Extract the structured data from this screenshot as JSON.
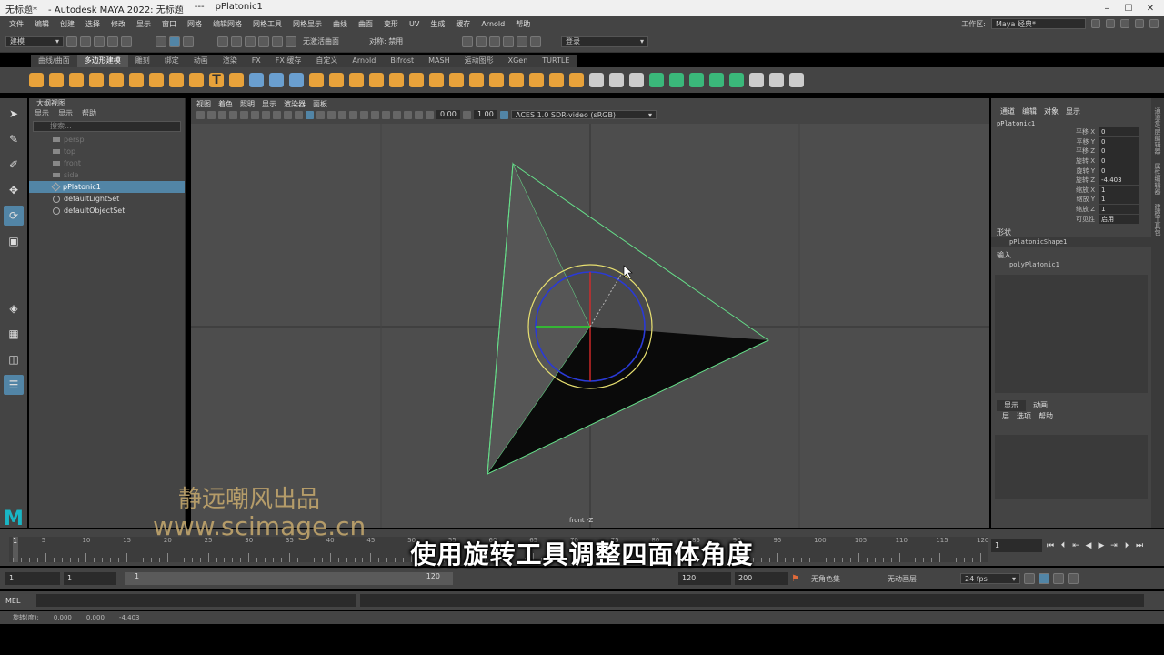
{
  "window": {
    "title_tab": "无标题*",
    "title": "- Autodesk MAYA 2022: 无标题",
    "separator": "---",
    "object": "pPlatonic1"
  },
  "menubar": {
    "items": [
      "文件",
      "编辑",
      "创建",
      "选择",
      "修改",
      "显示",
      "窗口",
      "网格",
      "编辑网格",
      "网格工具",
      "网格显示",
      "曲线",
      "曲面",
      "变形",
      "UV",
      "生成",
      "缓存",
      "Arnold",
      "帮助"
    ],
    "workspace_label": "工作区:",
    "workspace_value": "Maya 经典*"
  },
  "statusline": {
    "mode": "建模",
    "live_surface": "无激活曲面",
    "symmetry": "对称: 禁用",
    "login": "登录"
  },
  "shelf": {
    "tabs": [
      "曲线/曲面",
      "多边形建模",
      "雕刻",
      "绑定",
      "动画",
      "渲染",
      "FX",
      "FX 缓存",
      "自定义",
      "Arnold",
      "Bifrost",
      "MASH",
      "运动图形",
      "XGen",
      "TURTLE"
    ],
    "active_tab": 1
  },
  "outliner": {
    "title": "大纲视图",
    "menus": [
      "显示",
      "显示",
      "帮助"
    ],
    "search_placeholder": "搜索...",
    "items": [
      {
        "label": "persp",
        "type": "camera",
        "dim": true
      },
      {
        "label": "top",
        "type": "camera",
        "dim": true
      },
      {
        "label": "front",
        "type": "camera",
        "dim": true
      },
      {
        "label": "side",
        "type": "camera",
        "dim": true
      },
      {
        "label": "pPlatonic1",
        "type": "mesh",
        "selected": true
      },
      {
        "label": "defaultLightSet",
        "type": "set"
      },
      {
        "label": "defaultObjectSet",
        "type": "set"
      }
    ]
  },
  "viewport": {
    "menus": [
      "视图",
      "着色",
      "照明",
      "显示",
      "渲染器",
      "面板"
    ],
    "exposure": "0.00",
    "gamma": "1.00",
    "color_space": "ACES 1.0 SDR-video (sRGB)",
    "camera_label": "front -Z"
  },
  "channelbox": {
    "menus": [
      "通道",
      "编辑",
      "对象",
      "显示"
    ],
    "object": "pPlatonic1",
    "channels": [
      {
        "label": "平移 X",
        "value": "0"
      },
      {
        "label": "平移 Y",
        "value": "0"
      },
      {
        "label": "平移 Z",
        "value": "0"
      },
      {
        "label": "旋转 X",
        "value": "0"
      },
      {
        "label": "旋转 Y",
        "value": "0"
      },
      {
        "label": "旋转 Z",
        "value": "-4.403"
      },
      {
        "label": "缩放 X",
        "value": "1"
      },
      {
        "label": "缩放 Y",
        "value": "1"
      },
      {
        "label": "缩放 Z",
        "value": "1"
      },
      {
        "label": "可见性",
        "value": "启用"
      }
    ],
    "shapes_label": "形状",
    "shape_name": "pPlatonicShape1",
    "inputs_label": "输入",
    "input_name": "polyPlatonic1",
    "layer_tabs": [
      "显示",
      "动画"
    ],
    "layer_menus": [
      "层",
      "选项",
      "帮助"
    ]
  },
  "timeline": {
    "ticks": [
      1,
      5,
      10,
      15,
      20,
      25,
      30,
      35,
      40,
      45,
      50,
      55,
      60,
      65,
      70,
      75,
      80,
      85,
      90,
      95,
      100,
      105,
      110,
      115,
      120
    ],
    "current_frame": "1",
    "frame_field": "1"
  },
  "rangebar": {
    "start": "1",
    "start2": "1",
    "slider_start": "1",
    "slider_end": "120",
    "end": "120",
    "end2": "200",
    "character_set": "无角色集",
    "anim_layer": "无动画层",
    "fps": "24 fps"
  },
  "mel": {
    "label": "MEL"
  },
  "helpline": {
    "label": "旋转(度):",
    "x": "0.000",
    "y": "0.000",
    "z": "-4.403"
  },
  "overlay": {
    "subtitle": "使用旋转工具调整四面体角度",
    "watermark_line1": "静远嘲风出品",
    "watermark_line2": "www.scimage.cn",
    "logo": "M"
  },
  "colors": {
    "accent": "#5285a6",
    "wireframe": "#66e08a",
    "rotate_x": "#d62a2a",
    "rotate_y": "#2ad62a",
    "rotate_z": "#2a3ad6",
    "rotate_view": "#e8e070"
  }
}
